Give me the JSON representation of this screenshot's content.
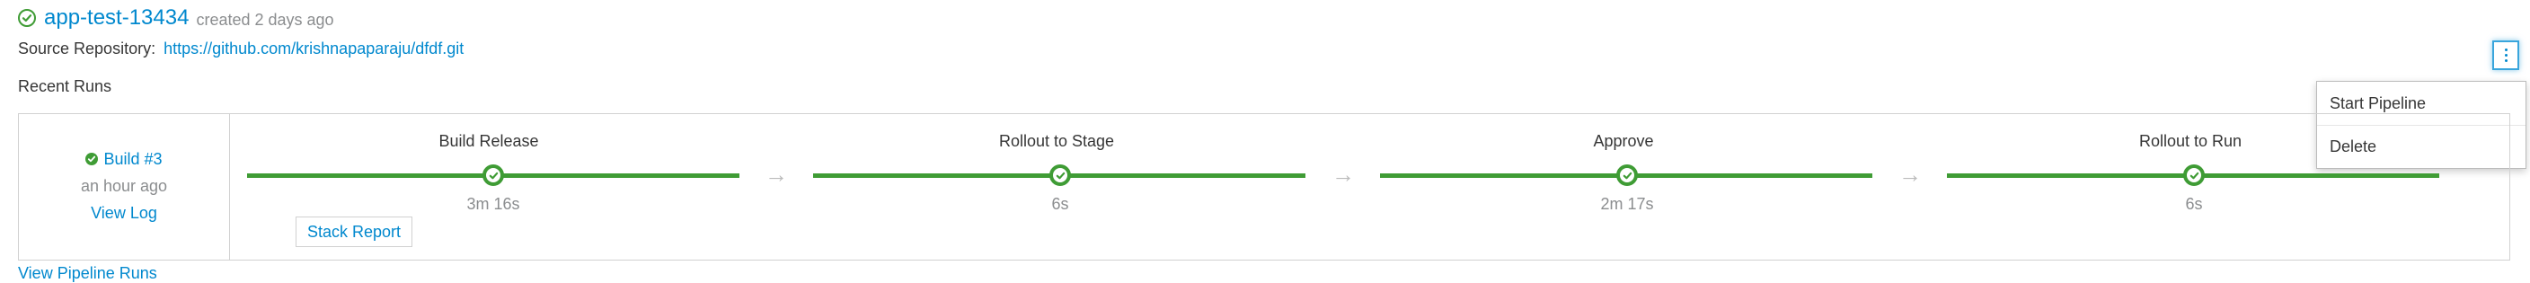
{
  "header": {
    "title": "app-test-13434",
    "created": "created 2 days ago",
    "status_icon": "check-circle-icon",
    "status_color": "#3f9c35"
  },
  "repository": {
    "label": "Source Repository:",
    "url": "https://github.com/krishnapaparaju/dfdf.git"
  },
  "recent_runs_label": "Recent Runs",
  "build": {
    "name": "Build #3",
    "time": "an hour ago",
    "view_log": "View Log"
  },
  "stages": [
    {
      "name": "Build Release",
      "duration": "3m 16s",
      "status": "complete"
    },
    {
      "name": "Rollout to Stage",
      "duration": "6s",
      "status": "complete"
    },
    {
      "name": "Approve",
      "duration": "2m 17s",
      "status": "complete"
    },
    {
      "name": "Rollout to Run",
      "duration": "6s",
      "status": "complete"
    }
  ],
  "stack_report_label": "Stack Report",
  "view_pipeline_runs": "View Pipeline Runs",
  "menu": {
    "kebab_icon": "kebab-vertical-icon",
    "items": [
      "Start Pipeline",
      "Delete"
    ]
  },
  "colors": {
    "link": "#0088ce",
    "success": "#3f9c35",
    "muted": "#8b8d8f",
    "border": "#d1d1d1"
  }
}
